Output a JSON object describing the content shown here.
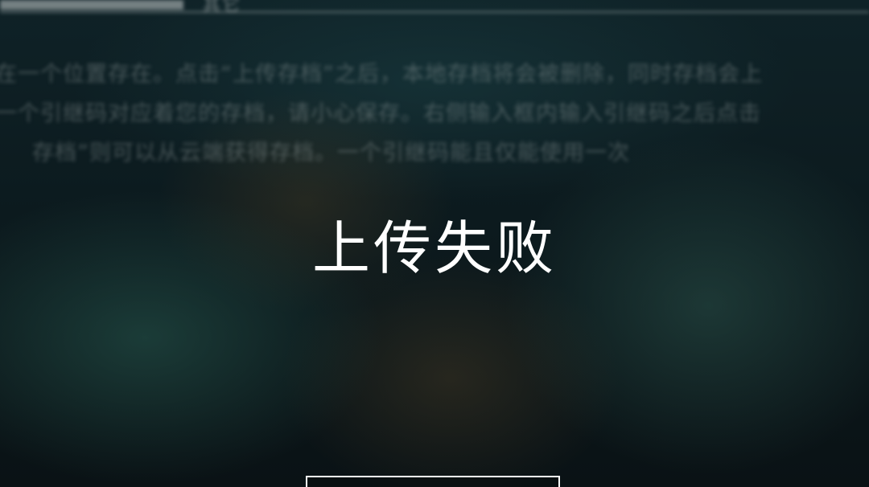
{
  "top_bar": {
    "tab_label": "其它"
  },
  "description": {
    "lines": [
      "在一个位置存在。点击“上传存档”之后，本地存档将会被删除，同时存档会上",
      "一个引继码对应着您的存档，请小心保存。右侧输入框内输入引继码之后点击",
      "存档”则可以从云端获得存档。一个引继码能且仅能使用一次"
    ]
  },
  "dialog": {
    "message": "上传失败"
  }
}
